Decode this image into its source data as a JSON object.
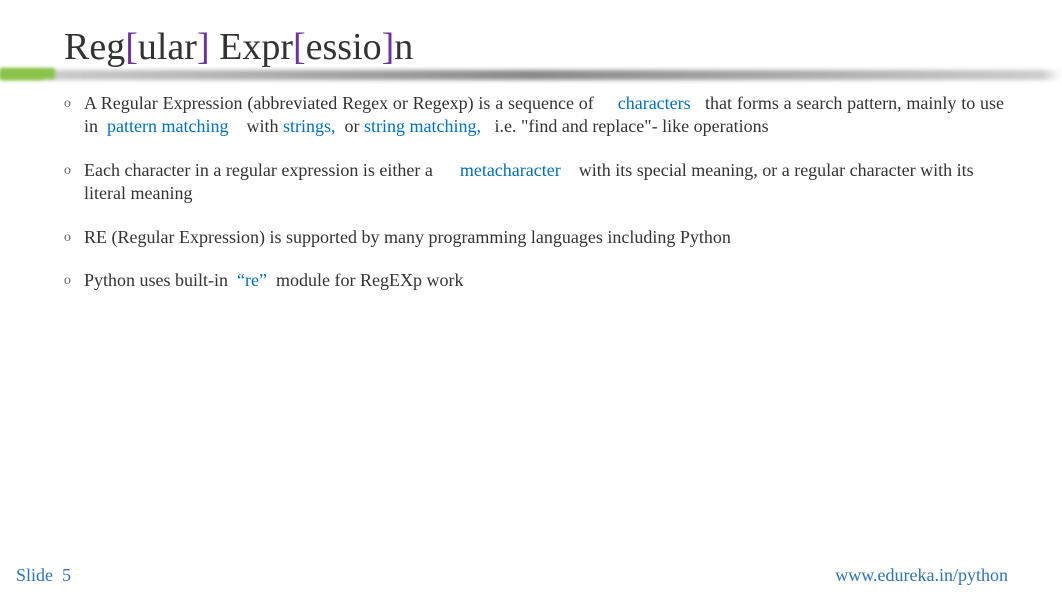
{
  "title": {
    "part1": "Reg",
    "bracket1": "[",
    "part2": "ular",
    "bracket2": "]",
    "part3": " Expr",
    "bracket3": "[",
    "part4": "essio",
    "bracket4": "]",
    "part5": "n"
  },
  "bullets": {
    "marker": "o",
    "item1": {
      "t1": "A Regular Expression (abbreviated Regex or Regexp) is a sequence of ",
      "link1": "characters",
      "t2": " that forms a search pattern, mainly to use in ",
      "link2": "pattern matching",
      "t3": " with ",
      "link3": "strings,",
      "t4": " or ",
      "link4": "string matching,",
      "t5": " i.e. \"find and replace\"- like operations"
    },
    "item2": {
      "t1": "Each character in a regular expression is either a ",
      "link1": "metacharacter",
      "t2": " with its special meaning, or a regular character with its literal meaning"
    },
    "item3": {
      "t1": "RE (Regular Expression) is supported by many programming languages including Python"
    },
    "item4": {
      "t1": "Python uses built-in ",
      "link1": "“re”",
      "t2": " module for RegEXp work"
    }
  },
  "footer": {
    "slide_label": "Slide",
    "slide_number": "5",
    "url": "www.edureka.in/python"
  }
}
